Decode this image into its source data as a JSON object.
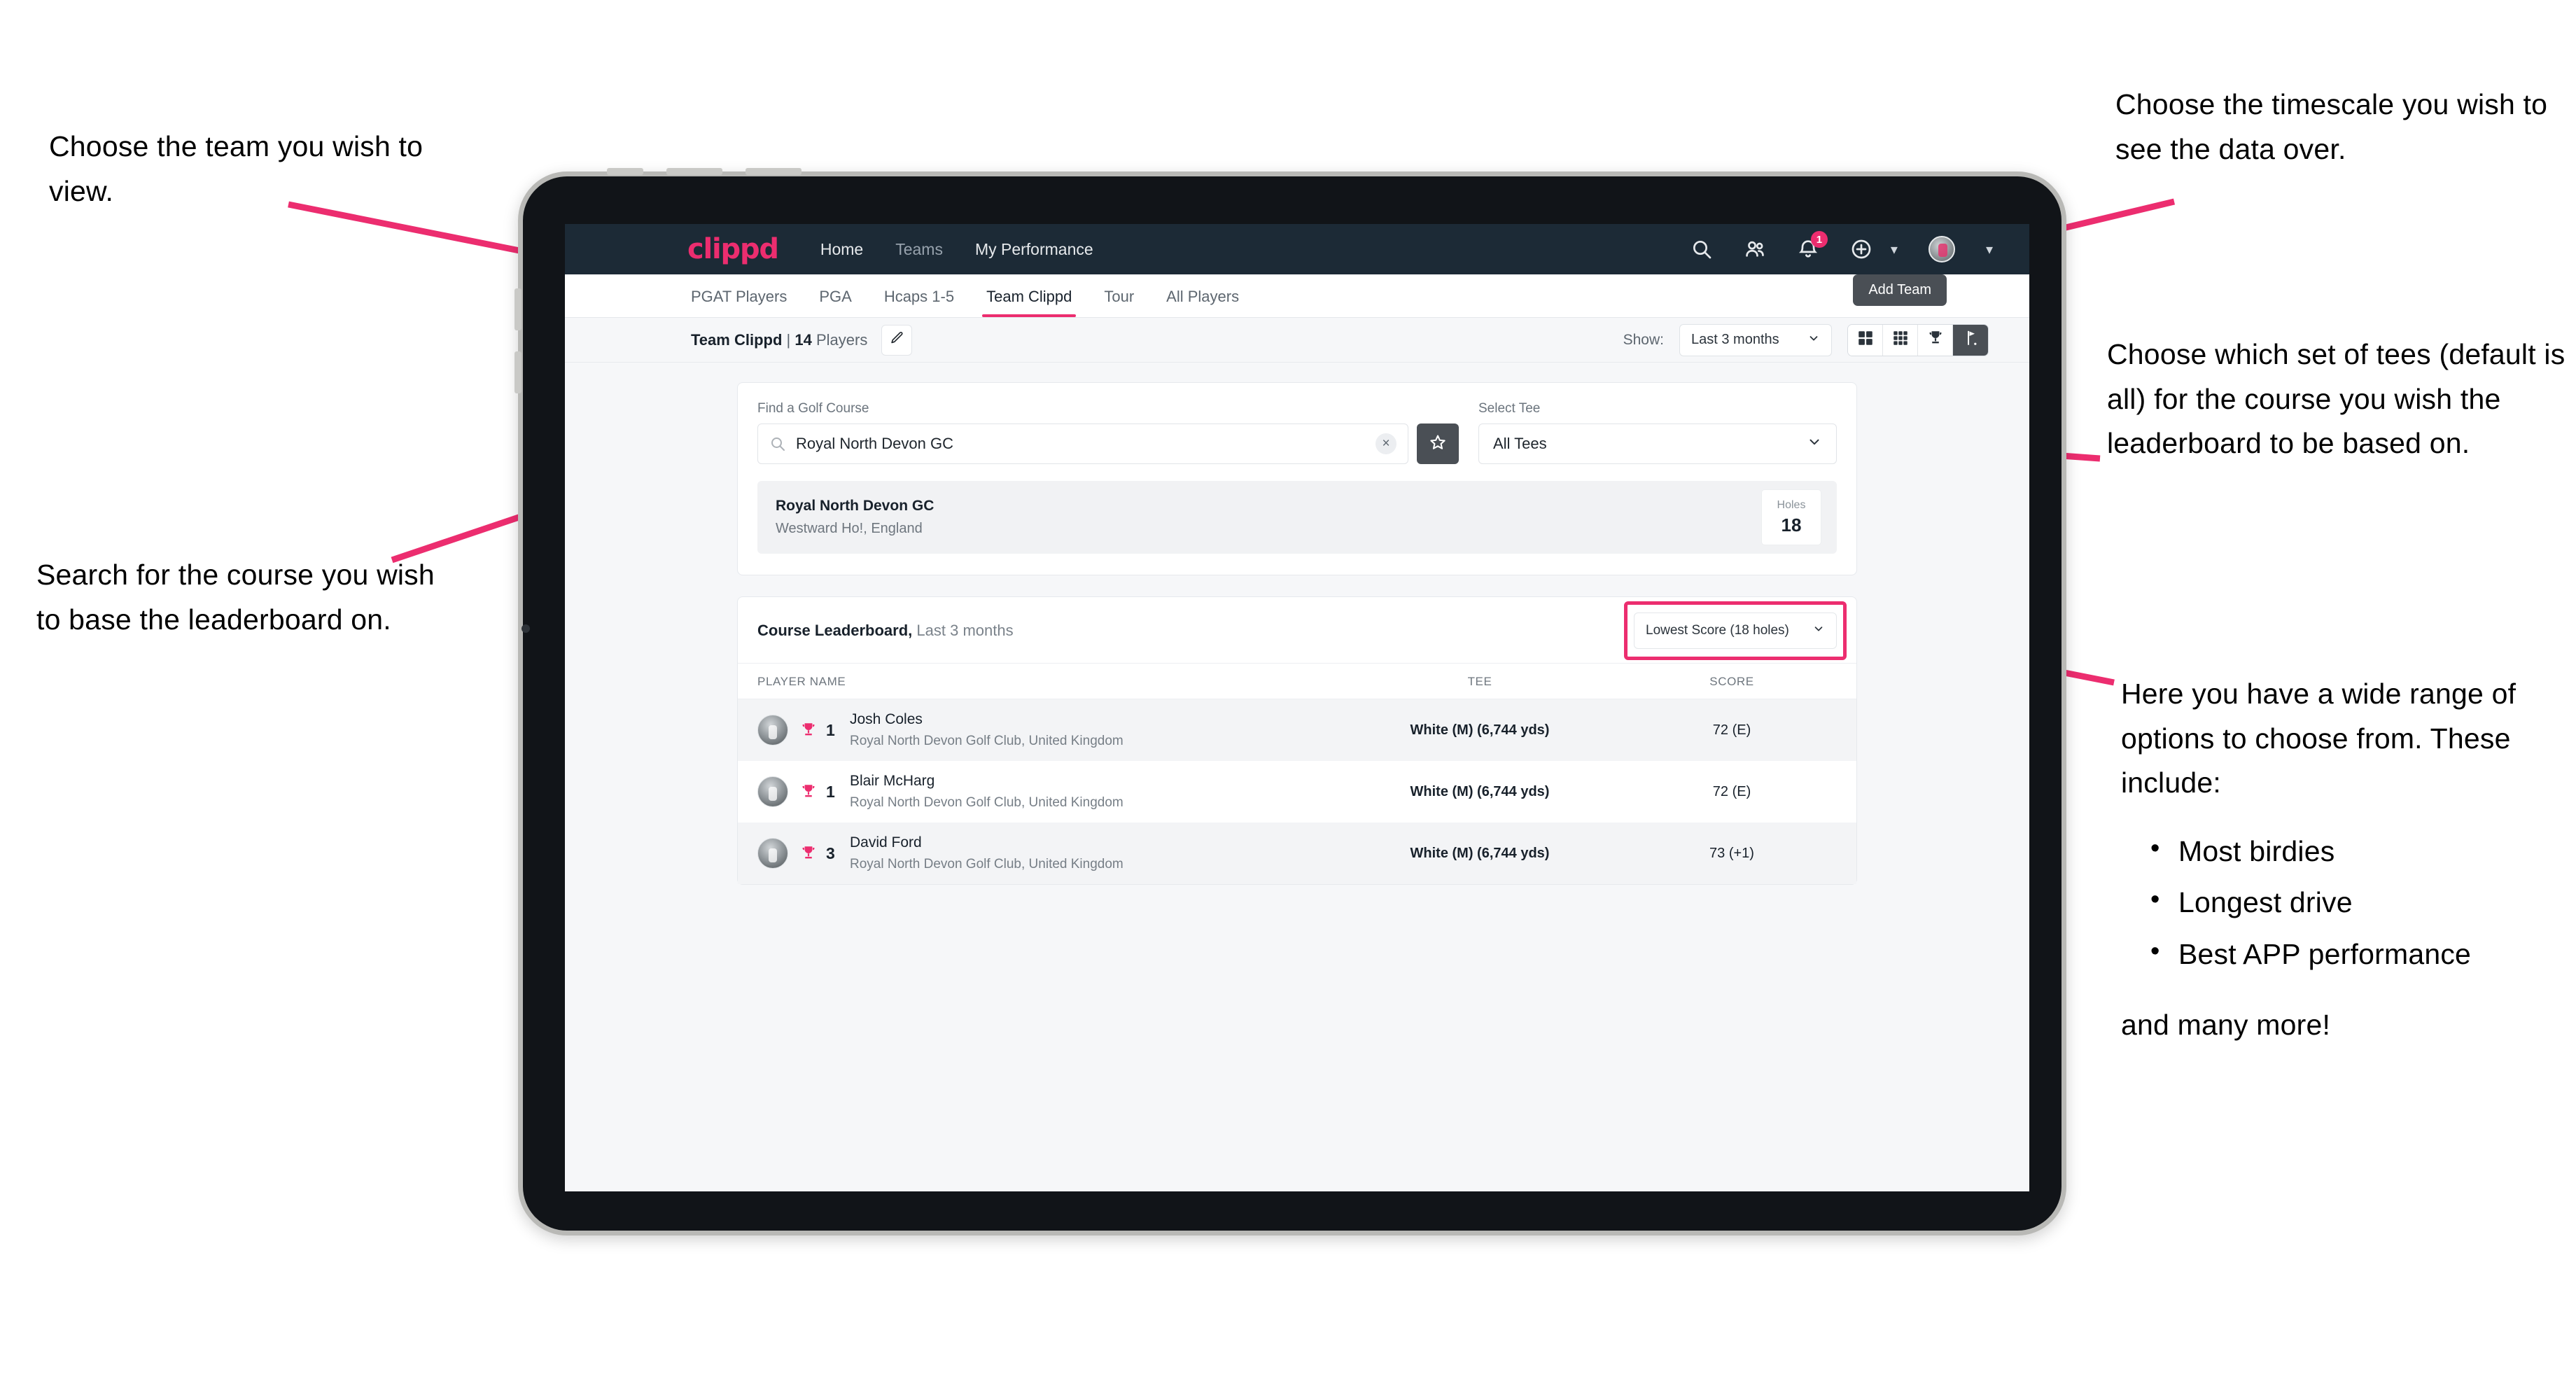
{
  "annotations": {
    "left_team": "Choose the team you wish to view.",
    "left_search": "Search for the course you wish to base the leaderboard on.",
    "right_timescale": "Choose the timescale you wish to see the data over.",
    "right_tees": "Choose which set of tees (default is all) for the course you wish the leaderboard to be based on.",
    "right_options_intro": "Here you have a wide range of options to choose from. These include:",
    "right_options_list": [
      "Most birdies",
      "Longest drive",
      "Best APP performance"
    ],
    "right_options_tail": "and many more!"
  },
  "topnav": {
    "brand": "clippd",
    "links": [
      "Home",
      "Teams",
      "My Performance"
    ],
    "icons": [
      "search-icon",
      "people-icon",
      "bell-icon",
      "plus-circle-icon",
      "avatar-icon"
    ],
    "notification_count": "1"
  },
  "tabs": {
    "items": [
      "PGAT Players",
      "PGA",
      "Hcaps 1-5",
      "Team Clippd",
      "Tour",
      "All Players"
    ],
    "active": "Team Clippd",
    "tooltip": "Add Team"
  },
  "subbar": {
    "team_name": "Team Clippd",
    "separator": "|",
    "player_count": "14",
    "players_word": "Players",
    "edit_icon": "pencil-icon",
    "show_label": "Show:",
    "show_value": "Last 3 months",
    "view_buttons": [
      "grid-large-icon",
      "grid-small-icon",
      "trophy-icon",
      "golf-flag-icon"
    ],
    "view_active": "golf-flag-icon"
  },
  "search_card": {
    "course_label": "Find a Golf Course",
    "course_value": "Royal North Devon GC",
    "course_placeholder": "Find a Golf Course",
    "clear_label": "×",
    "favourite_icon": "star-icon",
    "tee_label": "Select Tee",
    "tee_value": "All Tees",
    "result": {
      "name": "Royal North Devon GC",
      "location": "Westward Ho!, England",
      "holes_label": "Holes",
      "holes_value": "18"
    }
  },
  "leaderboard": {
    "title": "Course Leaderboard,",
    "subtitle": "Last 3 months",
    "sort_value": "Lowest Score (18 holes)",
    "columns": [
      "PLAYER NAME",
      "TEE",
      "SCORE"
    ],
    "rows": [
      {
        "rank": "1",
        "name": "Josh Coles",
        "club": "Royal North Devon Golf Club, United Kingdom",
        "tee": "White (M) (6,744 yds)",
        "score": "72 (E)"
      },
      {
        "rank": "1",
        "name": "Blair McHarg",
        "club": "Royal North Devon Golf Club, United Kingdom",
        "tee": "White (M) (6,744 yds)",
        "score": "72 (E)"
      },
      {
        "rank": "3",
        "name": "David Ford",
        "club": "Royal North Devon Golf Club, United Kingdom",
        "tee": "White (M) (6,744 yds)",
        "score": "73 (+1)"
      }
    ]
  },
  "colors": {
    "accent": "#ec2d6f",
    "nav_bg": "#1c2a36",
    "dark_btn": "#4a4f55",
    "page_bg": "#f6f7f9"
  }
}
